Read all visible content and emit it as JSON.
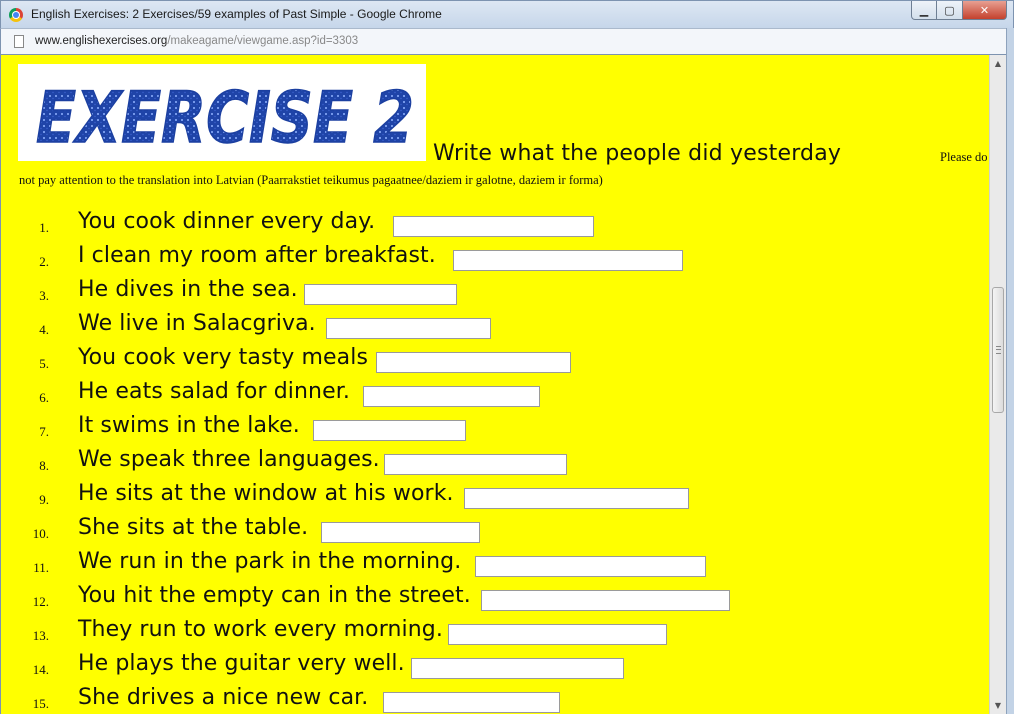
{
  "window": {
    "title": "English Exercises: 2 Exercises/59 examples of Past Simple - Google Chrome",
    "min_glyph": "▁",
    "max_glyph": "▢",
    "close_glyph": "✕"
  },
  "address_bar": {
    "host": "www.englishexercises.org",
    "path": "/makeagame/viewgame.asp?id=3303"
  },
  "banner": {
    "text": "EXERCISE 2",
    "color": "#1b3fa0"
  },
  "heading": "Write what the people did yesterday",
  "instructions": {
    "line1": "Please do",
    "line2": "not pay attention to the translation into Latvian (Paarrakstiet teikumus pagaatnee/daziem ir galotne, daziem ir forma)"
  },
  "questions": [
    {
      "n": "1.",
      "text": "You cook dinner every day.",
      "answer": ""
    },
    {
      "n": "2.",
      "text": "I clean my room after breakfast.",
      "answer": ""
    },
    {
      "n": "3.",
      "text": "He dives in the sea.",
      "answer": ""
    },
    {
      "n": "4.",
      "text": "We live in Salacgriva.",
      "answer": ""
    },
    {
      "n": "5.",
      "text": "You cook very tasty meals",
      "answer": ""
    },
    {
      "n": "6.",
      "text": "He eats salad for dinner.",
      "answer": ""
    },
    {
      "n": "7.",
      "text": "It swims in the lake.",
      "answer": ""
    },
    {
      "n": "8.",
      "text": "We speak three languages.",
      "answer": ""
    },
    {
      "n": "9.",
      "text": "He sits at the window at his work.",
      "answer": ""
    },
    {
      "n": "10.",
      "text": "She sits at the table.",
      "answer": ""
    },
    {
      "n": "11.",
      "text": "We run in the park in the morning.",
      "answer": ""
    },
    {
      "n": "12.",
      "text": "You hit the empty can in the street.",
      "answer": ""
    },
    {
      "n": "13.",
      "text": "They run to work every morning.",
      "answer": ""
    },
    {
      "n": "14.",
      "text": "He plays the guitar very well.",
      "answer": ""
    },
    {
      "n": "15.",
      "text": "She drives a nice new car.",
      "answer": ""
    }
  ],
  "colors": {
    "page_background": "#ffff00"
  }
}
